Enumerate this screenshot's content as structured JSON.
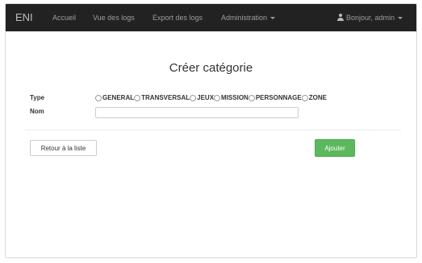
{
  "navbar": {
    "brand": "ENI",
    "items": [
      {
        "label": "Accueil"
      },
      {
        "label": "Vue des logs"
      },
      {
        "label": "Export des logs"
      },
      {
        "label": "Administration"
      }
    ],
    "user_label": "Bonjour, admin"
  },
  "page": {
    "title": "Créer catégorie"
  },
  "form": {
    "type_label": "Type",
    "name_label": "Nom",
    "name_value": "",
    "type_options": [
      "GENERAL",
      "TRANSVERSAL",
      "JEUX",
      "MISSION",
      "PERSONNAGE",
      "ZONE"
    ],
    "back_label": "Retour à la liste",
    "submit_label": "Ajouter"
  },
  "colors": {
    "navbar_bg": "#222222",
    "submit_bg": "#5cb85c"
  },
  "icons": {
    "user": "user-icon",
    "dropdown": "caret-down-icon"
  }
}
